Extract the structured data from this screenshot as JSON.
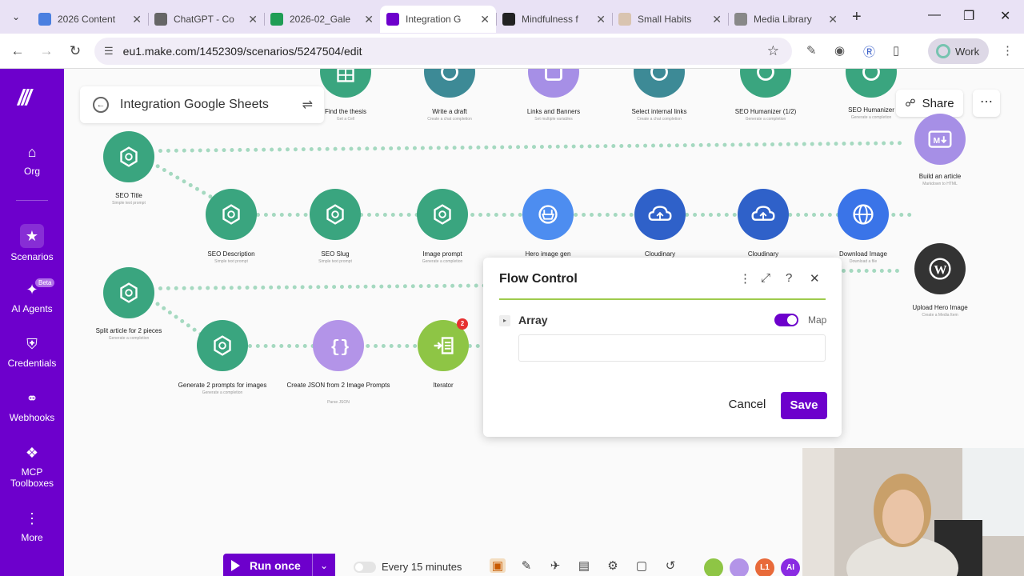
{
  "browser": {
    "tabs": [
      {
        "title": "2026 Content",
        "color": "#4a7fe0",
        "active": false
      },
      {
        "title": "ChatGPT - Co",
        "color": "#666666",
        "active": false
      },
      {
        "title": "2026-02_Gale",
        "color": "#1f9d55",
        "active": false
      },
      {
        "title": "Integration G",
        "color": "#6d00cc",
        "active": true
      },
      {
        "title": "Mindfulness f",
        "color": "#222222",
        "active": false
      },
      {
        "title": "Small Habits",
        "color": "#d9c4b0",
        "active": false
      },
      {
        "title": "Media Library",
        "color": "#888888",
        "active": false
      }
    ],
    "url": "eu1.make.com/1452309/scenarios/5247504/edit",
    "profile_label": "Work"
  },
  "sidebar": {
    "items": [
      {
        "label": "Org",
        "icon": "home-icon"
      },
      {
        "label": "Scenarios",
        "icon": "share-nodes-icon",
        "active": true
      },
      {
        "label": "AI Agents",
        "icon": "agent-icon",
        "badge": "Beta"
      },
      {
        "label": "Credentials",
        "icon": "shield-icon"
      },
      {
        "label": "Webhooks",
        "icon": "globe-icon"
      },
      {
        "label": "MCP Toolboxes",
        "icon": "mcp-icon"
      },
      {
        "label": "More",
        "icon": "more-vertical-icon"
      }
    ]
  },
  "scenario": {
    "title": "Integration Google Sheets",
    "share_label": "Share"
  },
  "modules": {
    "top_row": [
      "Find the thesis",
      "Write a draft",
      "Links and Banners",
      "Select internal links",
      "SEO Humanizer (1/2)",
      "SEO Humanizer"
    ],
    "top_row_sub": [
      "Get a Cell",
      "Create a chat completion",
      "Set multiple variables",
      "Create a chat completion",
      "Generate a completion",
      "Generate a completion"
    ],
    "seo_title": {
      "label": "SEO Title",
      "sub": "Simple text prompt"
    },
    "build_article": {
      "label": "Build an article",
      "sub": "Markdown to HTML"
    },
    "row2": [
      {
        "label": "SEO Description",
        "sub": "Simple text prompt"
      },
      {
        "label": "SEO Slug",
        "sub": "Simple text prompt"
      },
      {
        "label": "Image prompt",
        "sub": "Generate a completion"
      },
      {
        "label": "Hero image gen",
        "sub": ""
      },
      {
        "label": "Cloudinary",
        "sub": ""
      },
      {
        "label": "Cloudinary",
        "sub": ""
      },
      {
        "label": "Download Image",
        "sub": "Download a file"
      }
    ],
    "upload_hero": {
      "label": "Upload Hero Image",
      "sub": "Create a Media Item"
    },
    "split": {
      "label": "Split article for 2 pieces",
      "sub": "Generate a completion"
    },
    "row3": [
      {
        "label": "Generate 2 prompts for images",
        "sub": "Generate a completion"
      },
      {
        "label": "Create JSON from 2 Image Prompts",
        "sub": "Parse JSON"
      },
      {
        "label": "Iterator",
        "sub": ""
      }
    ],
    "iterator_badge": "2"
  },
  "panel": {
    "title": "Flow Control",
    "field_label": "Array",
    "map_label": "Map",
    "map_on": true,
    "field_value": "",
    "cancel_label": "Cancel",
    "save_label": "Save"
  },
  "toolbar": {
    "run_label": "Run once",
    "schedule_label": "Every 15 minutes",
    "apps": [
      "",
      "",
      "L1",
      "AI"
    ]
  },
  "colors": {
    "brand": "#6d00cc",
    "openai": "#3aa57f",
    "connector": "#a5d9c0"
  }
}
